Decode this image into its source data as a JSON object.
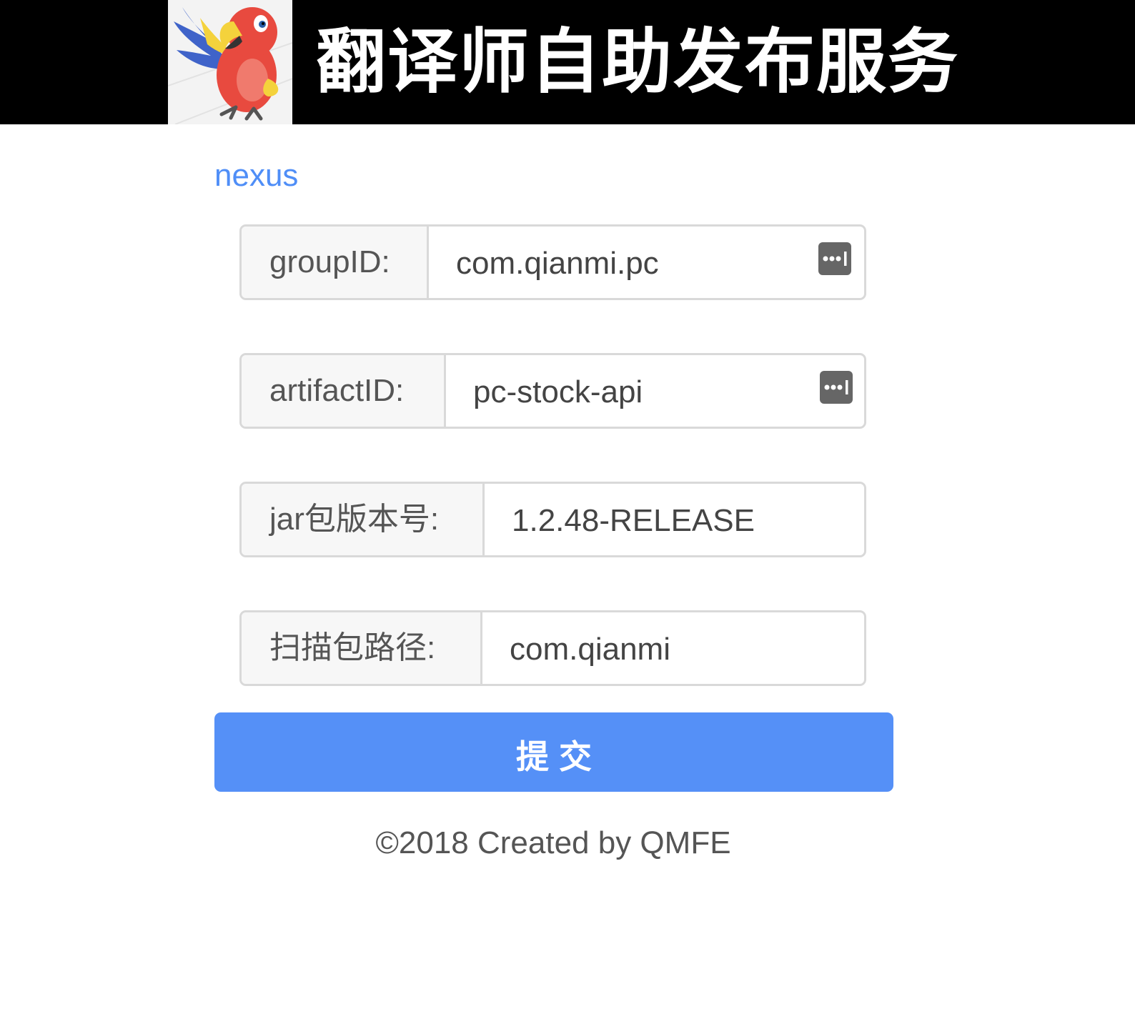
{
  "header": {
    "title": "翻译师自助发布服务",
    "logo_icon": "parrot-logo"
  },
  "section": {
    "link_label": "nexus"
  },
  "form": {
    "fields": [
      {
        "label": "groupID:",
        "value": "com.qianmi.pc",
        "autofill_icon": "keychain-autofill-icon"
      },
      {
        "label": "artifactID:",
        "value": "pc-stock-api",
        "autofill_icon": "keychain-autofill-icon"
      },
      {
        "label": "jar包版本号:",
        "value": "1.2.48-RELEASE"
      },
      {
        "label": "扫描包路径:",
        "value": "com.qianmi"
      }
    ],
    "submit_label": "提交"
  },
  "footer": {
    "text": "©2018 Created by QMFE"
  },
  "colors": {
    "header_bg": "#000000",
    "link": "#4f8ef7",
    "primary_button": "#5590f7",
    "border": "#d9d9d9"
  }
}
